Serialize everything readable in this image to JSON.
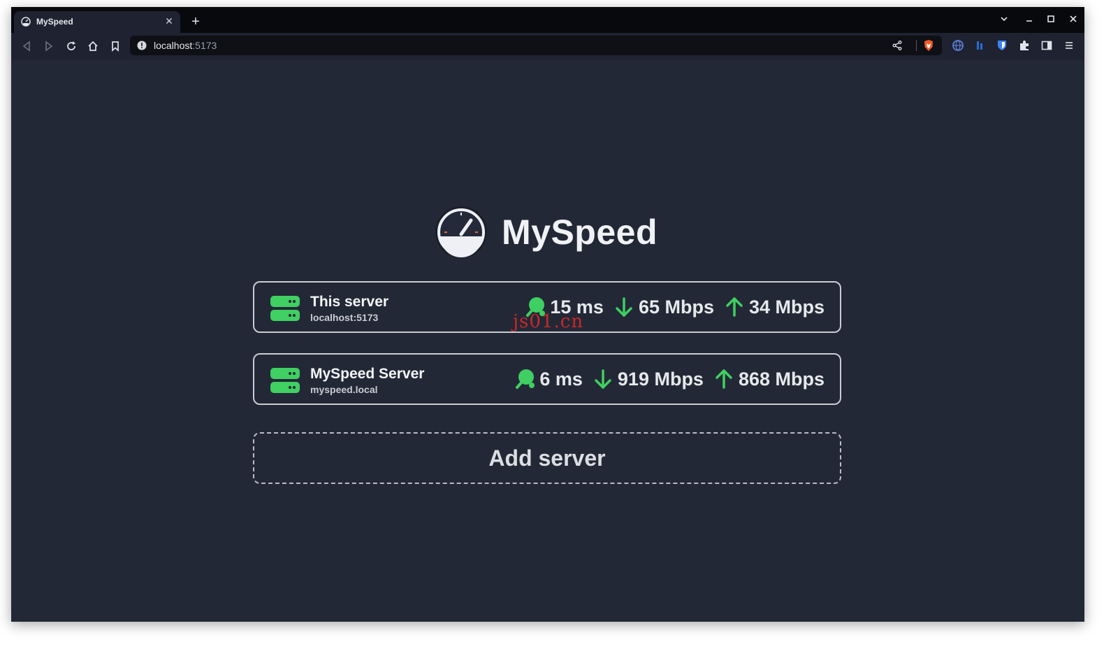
{
  "browser": {
    "tab_title": "MySpeed",
    "url_host": "localhost",
    "url_port": ":5173"
  },
  "app": {
    "name": "MySpeed",
    "add_server_label": "Add server"
  },
  "servers": [
    {
      "title": "This server",
      "subtitle": "localhost:5173",
      "ping": "15 ms",
      "download": "65 Mbps",
      "upload": "34 Mbps"
    },
    {
      "title": "MySpeed Server",
      "subtitle": "myspeed.local",
      "ping": "6 ms",
      "download": "919 Mbps",
      "upload": "868 Mbps"
    }
  ],
  "watermark": "js01.cn",
  "colors": {
    "accent_green": "#3fcf62",
    "page_bg": "#232836",
    "text": "#e6e8ec"
  },
  "icons": {
    "server": "server-icon",
    "ping": "ping-pong-icon",
    "download": "arrow-down-icon",
    "upload": "arrow-up-icon",
    "logo": "speedometer-icon"
  }
}
